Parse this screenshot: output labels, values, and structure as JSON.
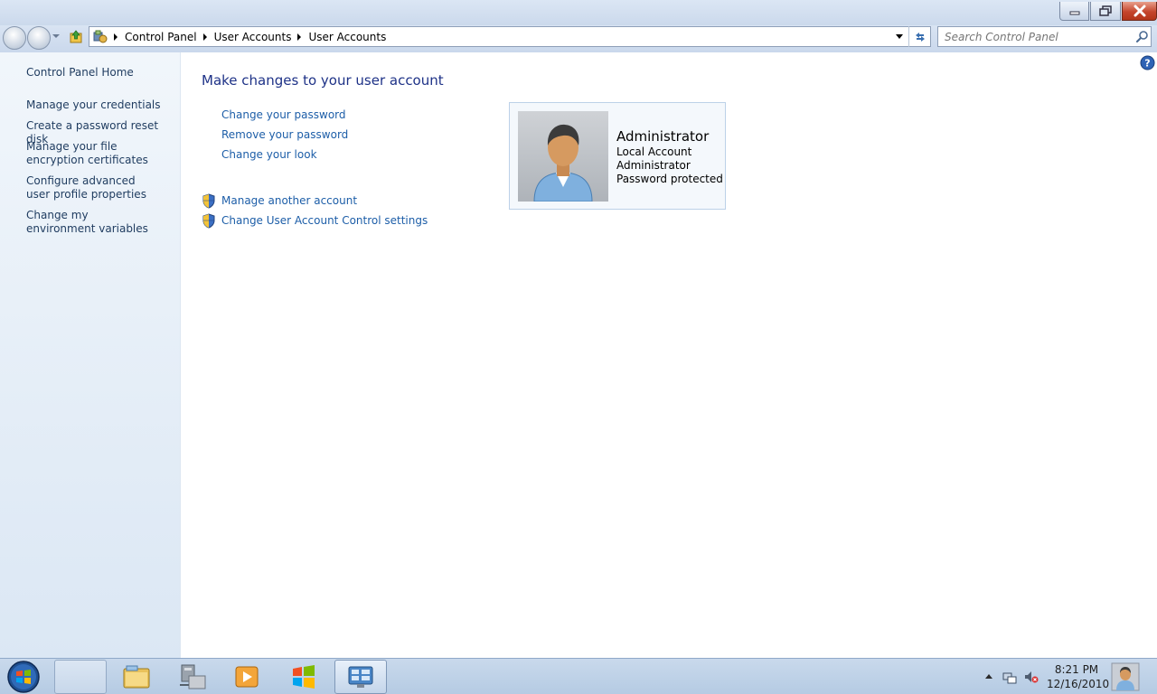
{
  "window": {
    "caption_buttons": [
      "minimize-icon",
      "maximize-icon",
      "close-icon"
    ]
  },
  "navigation": {
    "breadcrumbs": [
      "Control Panel",
      "User Accounts",
      "User Accounts"
    ],
    "search_placeholder": "Search Control Panel",
    "icons": [
      "back-icon",
      "forward-icon",
      "up-icon",
      "control-panel-icon",
      "refresh-icon",
      "search-icon"
    ]
  },
  "sidebar": {
    "items": [
      {
        "label": "Control Panel Home"
      },
      {
        "label": "Manage your credentials"
      },
      {
        "label": "Create a password reset disk"
      },
      {
        "label": "Manage your file encryption certificates"
      },
      {
        "label": "Configure advanced user profile properties"
      },
      {
        "label": "Change my environment variables"
      }
    ]
  },
  "main": {
    "title": "Make changes to your user account",
    "links": [
      {
        "label": "Change your password"
      },
      {
        "label": "Remove your password"
      },
      {
        "label": "Change your look"
      }
    ],
    "admin_links": [
      {
        "label": "Manage another account",
        "icon": "shield-icon"
      },
      {
        "label": "Change User Account Control settings",
        "icon": "shield-icon"
      }
    ]
  },
  "account": {
    "name": "Administrator",
    "details": [
      "Local Account",
      "Administrator",
      "Password protected"
    ]
  },
  "taskbar": {
    "clock_time": "8:21 PM",
    "clock_date": "12/16/2010",
    "apps": [
      "blank-window",
      "windows-explorer-icon",
      "network-folder-icon",
      "media-player-icon",
      "windows-logo-icon",
      "control-panel-icon"
    ],
    "tray": [
      "show-hidden-icons-arrow",
      "network-icon",
      "volume-muted-icon"
    ]
  },
  "colors": {
    "link": "#1d5ea8",
    "title": "#1e3287",
    "sidebar_link": "#1e3b5f",
    "close_button": "#c5452c"
  }
}
